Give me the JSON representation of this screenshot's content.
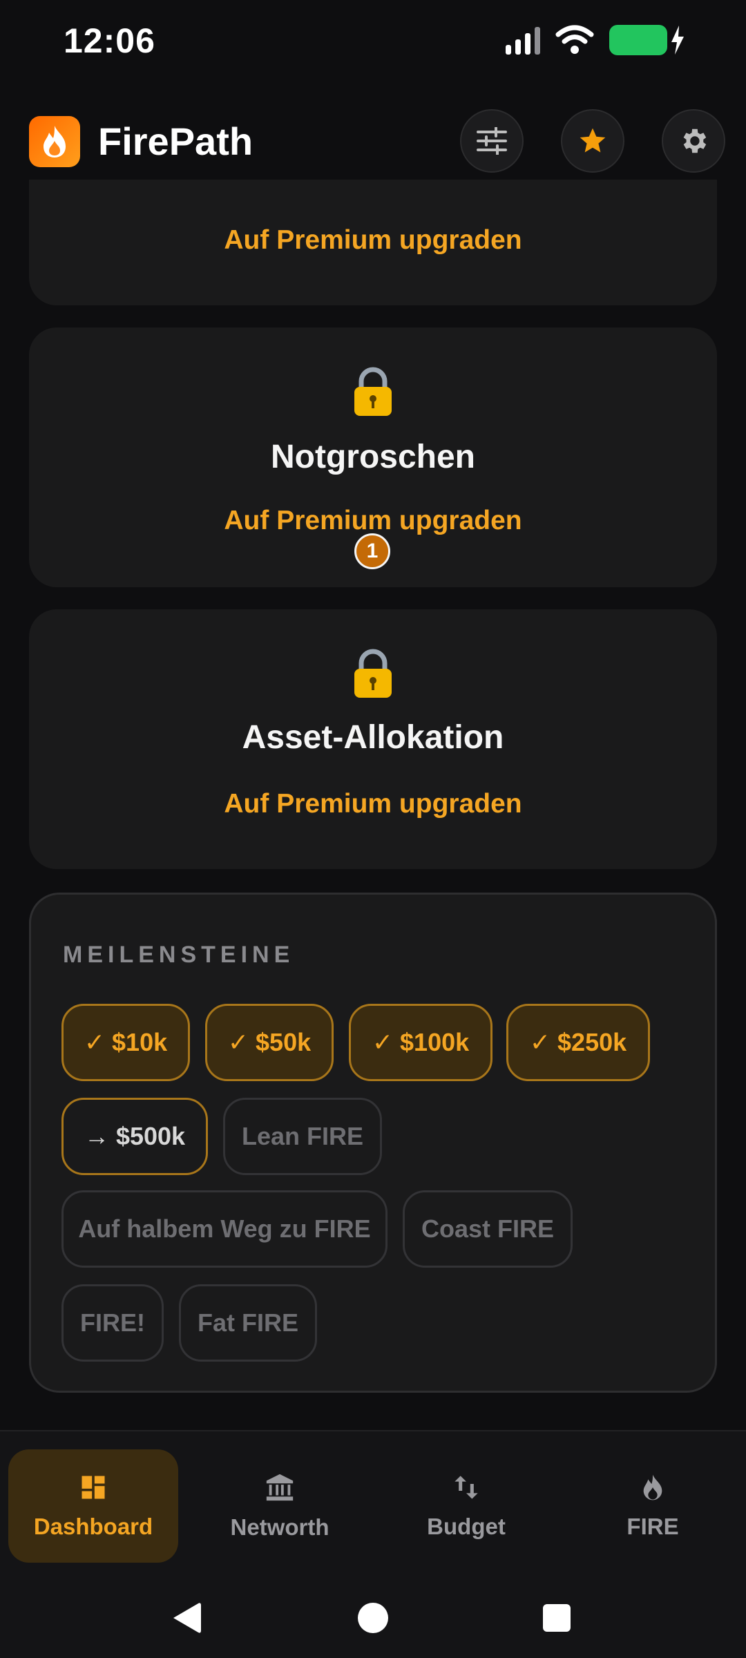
{
  "status_bar": {
    "time": "12:06"
  },
  "header": {
    "title": "FirePath"
  },
  "cards": [
    {
      "title": "",
      "upgrade_label": "Auf Premium upgraden"
    },
    {
      "title": "Notgroschen",
      "upgrade_label": "Auf Premium upgraden"
    },
    {
      "title": "Asset-Allokation",
      "upgrade_label": "Auf Premium upgraden"
    }
  ],
  "badge": {
    "count": "1"
  },
  "milestones": {
    "title": "MEILENSTEINE",
    "chips": [
      {
        "label": "✓ $10k",
        "state": "done"
      },
      {
        "label": "✓ $50k",
        "state": "done"
      },
      {
        "label": "✓ $100k",
        "state": "done"
      },
      {
        "label": "✓ $250k",
        "state": "done"
      },
      {
        "label": "→ $500k",
        "state": "next"
      },
      {
        "label": "Lean FIRE",
        "state": "todo"
      },
      {
        "label": "Auf halbem Weg zu FIRE",
        "state": "todo"
      },
      {
        "label": "Coast FIRE",
        "state": "todo"
      },
      {
        "label": "FIRE!",
        "state": "todo"
      },
      {
        "label": "Fat FIRE",
        "state": "todo"
      }
    ]
  },
  "nav": {
    "items": [
      {
        "label": "Dashboard",
        "icon": "dashboard-icon",
        "active": true
      },
      {
        "label": "Networth",
        "icon": "bank-icon",
        "active": false
      },
      {
        "label": "Budget",
        "icon": "swap-vertical-icon",
        "active": false
      },
      {
        "label": "FIRE",
        "icon": "flame-icon",
        "active": false
      }
    ]
  },
  "colors": {
    "accent": "#f5a623",
    "background": "#0e0e10",
    "card": "#1a1a1b"
  }
}
